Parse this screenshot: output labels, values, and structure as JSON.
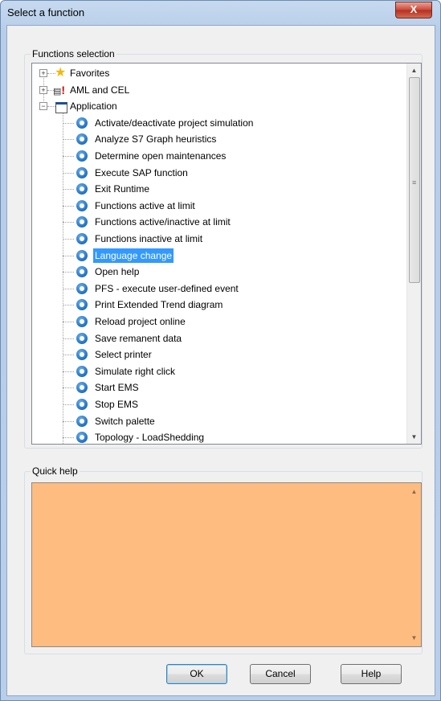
{
  "window": {
    "title": "Select a function",
    "close_glyph": "X"
  },
  "functions_group": {
    "label": "Functions selection"
  },
  "tree": {
    "roots": [
      {
        "label": "Favorites",
        "icon": "star-icon",
        "expander": "+"
      },
      {
        "label": "AML and CEL",
        "icon": "alert-list-icon",
        "expander": "+"
      },
      {
        "label": "Application",
        "icon": "application-window-icon",
        "expander": "−"
      }
    ],
    "children": [
      {
        "label": "Activate/deactivate project simulation"
      },
      {
        "label": "Analyze S7 Graph heuristics"
      },
      {
        "label": "Determine open maintenances"
      },
      {
        "label": "Execute SAP function"
      },
      {
        "label": "Exit Runtime"
      },
      {
        "label": "Functions active at limit"
      },
      {
        "label": "Functions active/inactive at limit"
      },
      {
        "label": "Functions inactive at limit"
      },
      {
        "label": "Language change",
        "selected": true
      },
      {
        "label": "Open help"
      },
      {
        "label": "PFS - execute user-defined event"
      },
      {
        "label": "Print Extended Trend diagram"
      },
      {
        "label": "Reload project online"
      },
      {
        "label": "Save remanent data"
      },
      {
        "label": "Select printer"
      },
      {
        "label": "Simulate right click"
      },
      {
        "label": "Start EMS"
      },
      {
        "label": "Stop EMS"
      },
      {
        "label": "Switch palette"
      },
      {
        "label": "Topology - LoadShedding"
      }
    ]
  },
  "quick_help": {
    "label": "Quick help",
    "text": ""
  },
  "buttons": {
    "ok": "OK",
    "cancel": "Cancel",
    "help": "Help"
  },
  "colors": {
    "selection": "#3399ff",
    "quick_help_bg": "#ffbc80"
  }
}
